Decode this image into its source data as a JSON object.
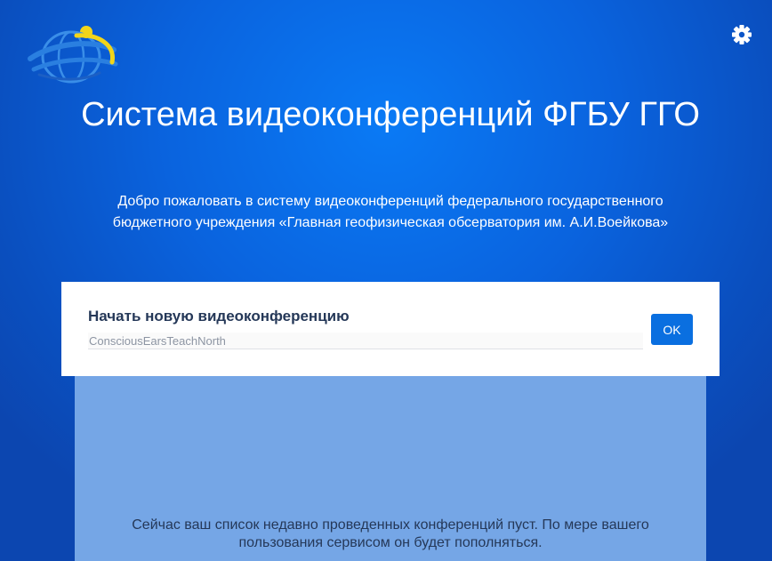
{
  "header": {
    "logo_icon": "globe-logo-icon",
    "settings_icon": "gear-icon",
    "title": "Система видеоконференций ФГБУ ГГО",
    "subtitle": "Добро пожаловать в систему видеоконференций федерального государственного бюджетного учреждения «Главная геофизическая обсерватория им. А.И.Воейкова»"
  },
  "start_meeting": {
    "label": "Начать новую видеоконференцию",
    "input_value": "",
    "input_placeholder": "ConsciousEarsTeachNorth",
    "ok_label": "OK"
  },
  "recent": {
    "empty_message": "Сейчас ваш список недавно проведенных конференций пуст. По мере вашего пользования сервисом он будет пополняться."
  },
  "colors": {
    "background": "#0a63de",
    "button": "#0a6fe0",
    "panel": "#75a6e6",
    "heading_text": "#253858",
    "logo_yellow": "#f2d51a"
  }
}
